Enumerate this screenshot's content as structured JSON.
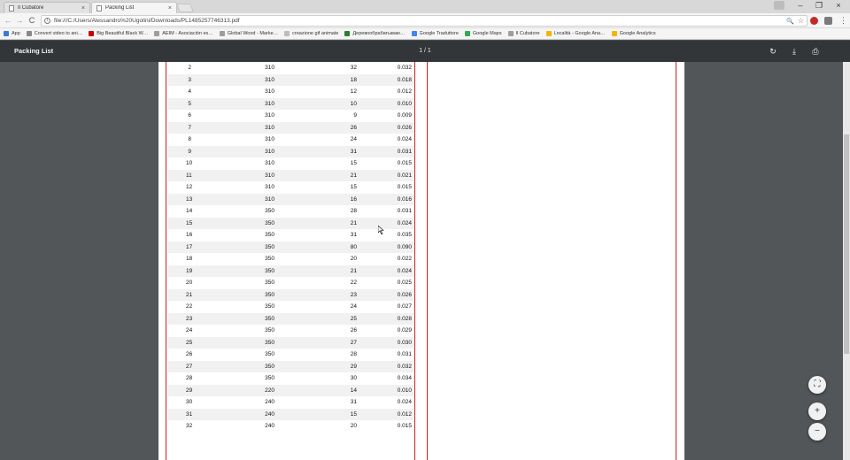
{
  "tabs": [
    {
      "title": "Il Cubatore",
      "close": "×"
    },
    {
      "title": "Packing List",
      "close": "×"
    }
  ],
  "window": {
    "minimize": "–",
    "restore": "❐",
    "close": "×"
  },
  "toolbar": {
    "back": "←",
    "forward": "→",
    "reload": "C",
    "info": "i",
    "url": "file:///C:/Users/Alessandro%20Ugolini/Downloads/PL1485257746313.pdf",
    "zoom": "🔍",
    "star": "☆",
    "menu": "⋮"
  },
  "bookmarks": [
    {
      "label": "App",
      "color": "#3c78d8"
    },
    {
      "label": "Convert video to ani…",
      "color": "#888888"
    },
    {
      "label": "Big Beautiful Black W…",
      "color": "#cc0000"
    },
    {
      "label": "AEIM - Asociación es…",
      "color": "#9e9e9e"
    },
    {
      "label": "Global Wood - Marke…",
      "color": "#9e9e9e"
    },
    {
      "label": "creazione gif animate",
      "color": "#bdbdbd"
    },
    {
      "label": "Деревообрабатываю…",
      "color": "#2e7d32"
    },
    {
      "label": "Google Traduttore",
      "color": "#4285f4"
    },
    {
      "label": "Google Maps",
      "color": "#34a853"
    },
    {
      "label": "Il Cubatore",
      "color": "#9e9e9e"
    },
    {
      "label": "Località - Google Ana…",
      "color": "#f4b400"
    },
    {
      "label": "Google Analytics",
      "color": "#f4b400"
    }
  ],
  "viewer": {
    "title": "Packing List",
    "page_indicator": "1 / 1",
    "rotate_icon": "↻",
    "download_icon": "⤓",
    "print_icon": "⎙",
    "fit_icon": "⛶",
    "zoom_in": "+",
    "zoom_out": "−"
  },
  "table": {
    "rows": [
      [
        "2",
        "310",
        "32",
        "0.032"
      ],
      [
        "3",
        "310",
        "18",
        "0.018"
      ],
      [
        "4",
        "310",
        "12",
        "0.012"
      ],
      [
        "5",
        "310",
        "10",
        "0.010"
      ],
      [
        "6",
        "310",
        "9",
        "0.009"
      ],
      [
        "7",
        "310",
        "26",
        "0.026"
      ],
      [
        "8",
        "310",
        "24",
        "0.024"
      ],
      [
        "9",
        "310",
        "31",
        "0.031"
      ],
      [
        "10",
        "310",
        "15",
        "0.015"
      ],
      [
        "11",
        "310",
        "21",
        "0.021"
      ],
      [
        "12",
        "310",
        "15",
        "0.015"
      ],
      [
        "13",
        "310",
        "16",
        "0.016"
      ],
      [
        "14",
        "350",
        "28",
        "0.031"
      ],
      [
        "15",
        "350",
        "21",
        "0.024"
      ],
      [
        "16",
        "350",
        "31",
        "0.035"
      ],
      [
        "17",
        "350",
        "80",
        "0.090"
      ],
      [
        "18",
        "350",
        "20",
        "0.022"
      ],
      [
        "19",
        "350",
        "21",
        "0.024"
      ],
      [
        "20",
        "350",
        "22",
        "0.025"
      ],
      [
        "21",
        "350",
        "23",
        "0.026"
      ],
      [
        "22",
        "350",
        "24",
        "0.027"
      ],
      [
        "23",
        "350",
        "25",
        "0.028"
      ],
      [
        "24",
        "350",
        "26",
        "0.029"
      ],
      [
        "25",
        "350",
        "27",
        "0.030"
      ],
      [
        "26",
        "350",
        "28",
        "0.031"
      ],
      [
        "27",
        "350",
        "29",
        "0.032"
      ],
      [
        "28",
        "350",
        "30",
        "0.034"
      ],
      [
        "29",
        "220",
        "14",
        "0.010"
      ],
      [
        "30",
        "240",
        "31",
        "0.024"
      ],
      [
        "31",
        "240",
        "15",
        "0.012"
      ],
      [
        "32",
        "240",
        "20",
        "0.015"
      ]
    ]
  }
}
